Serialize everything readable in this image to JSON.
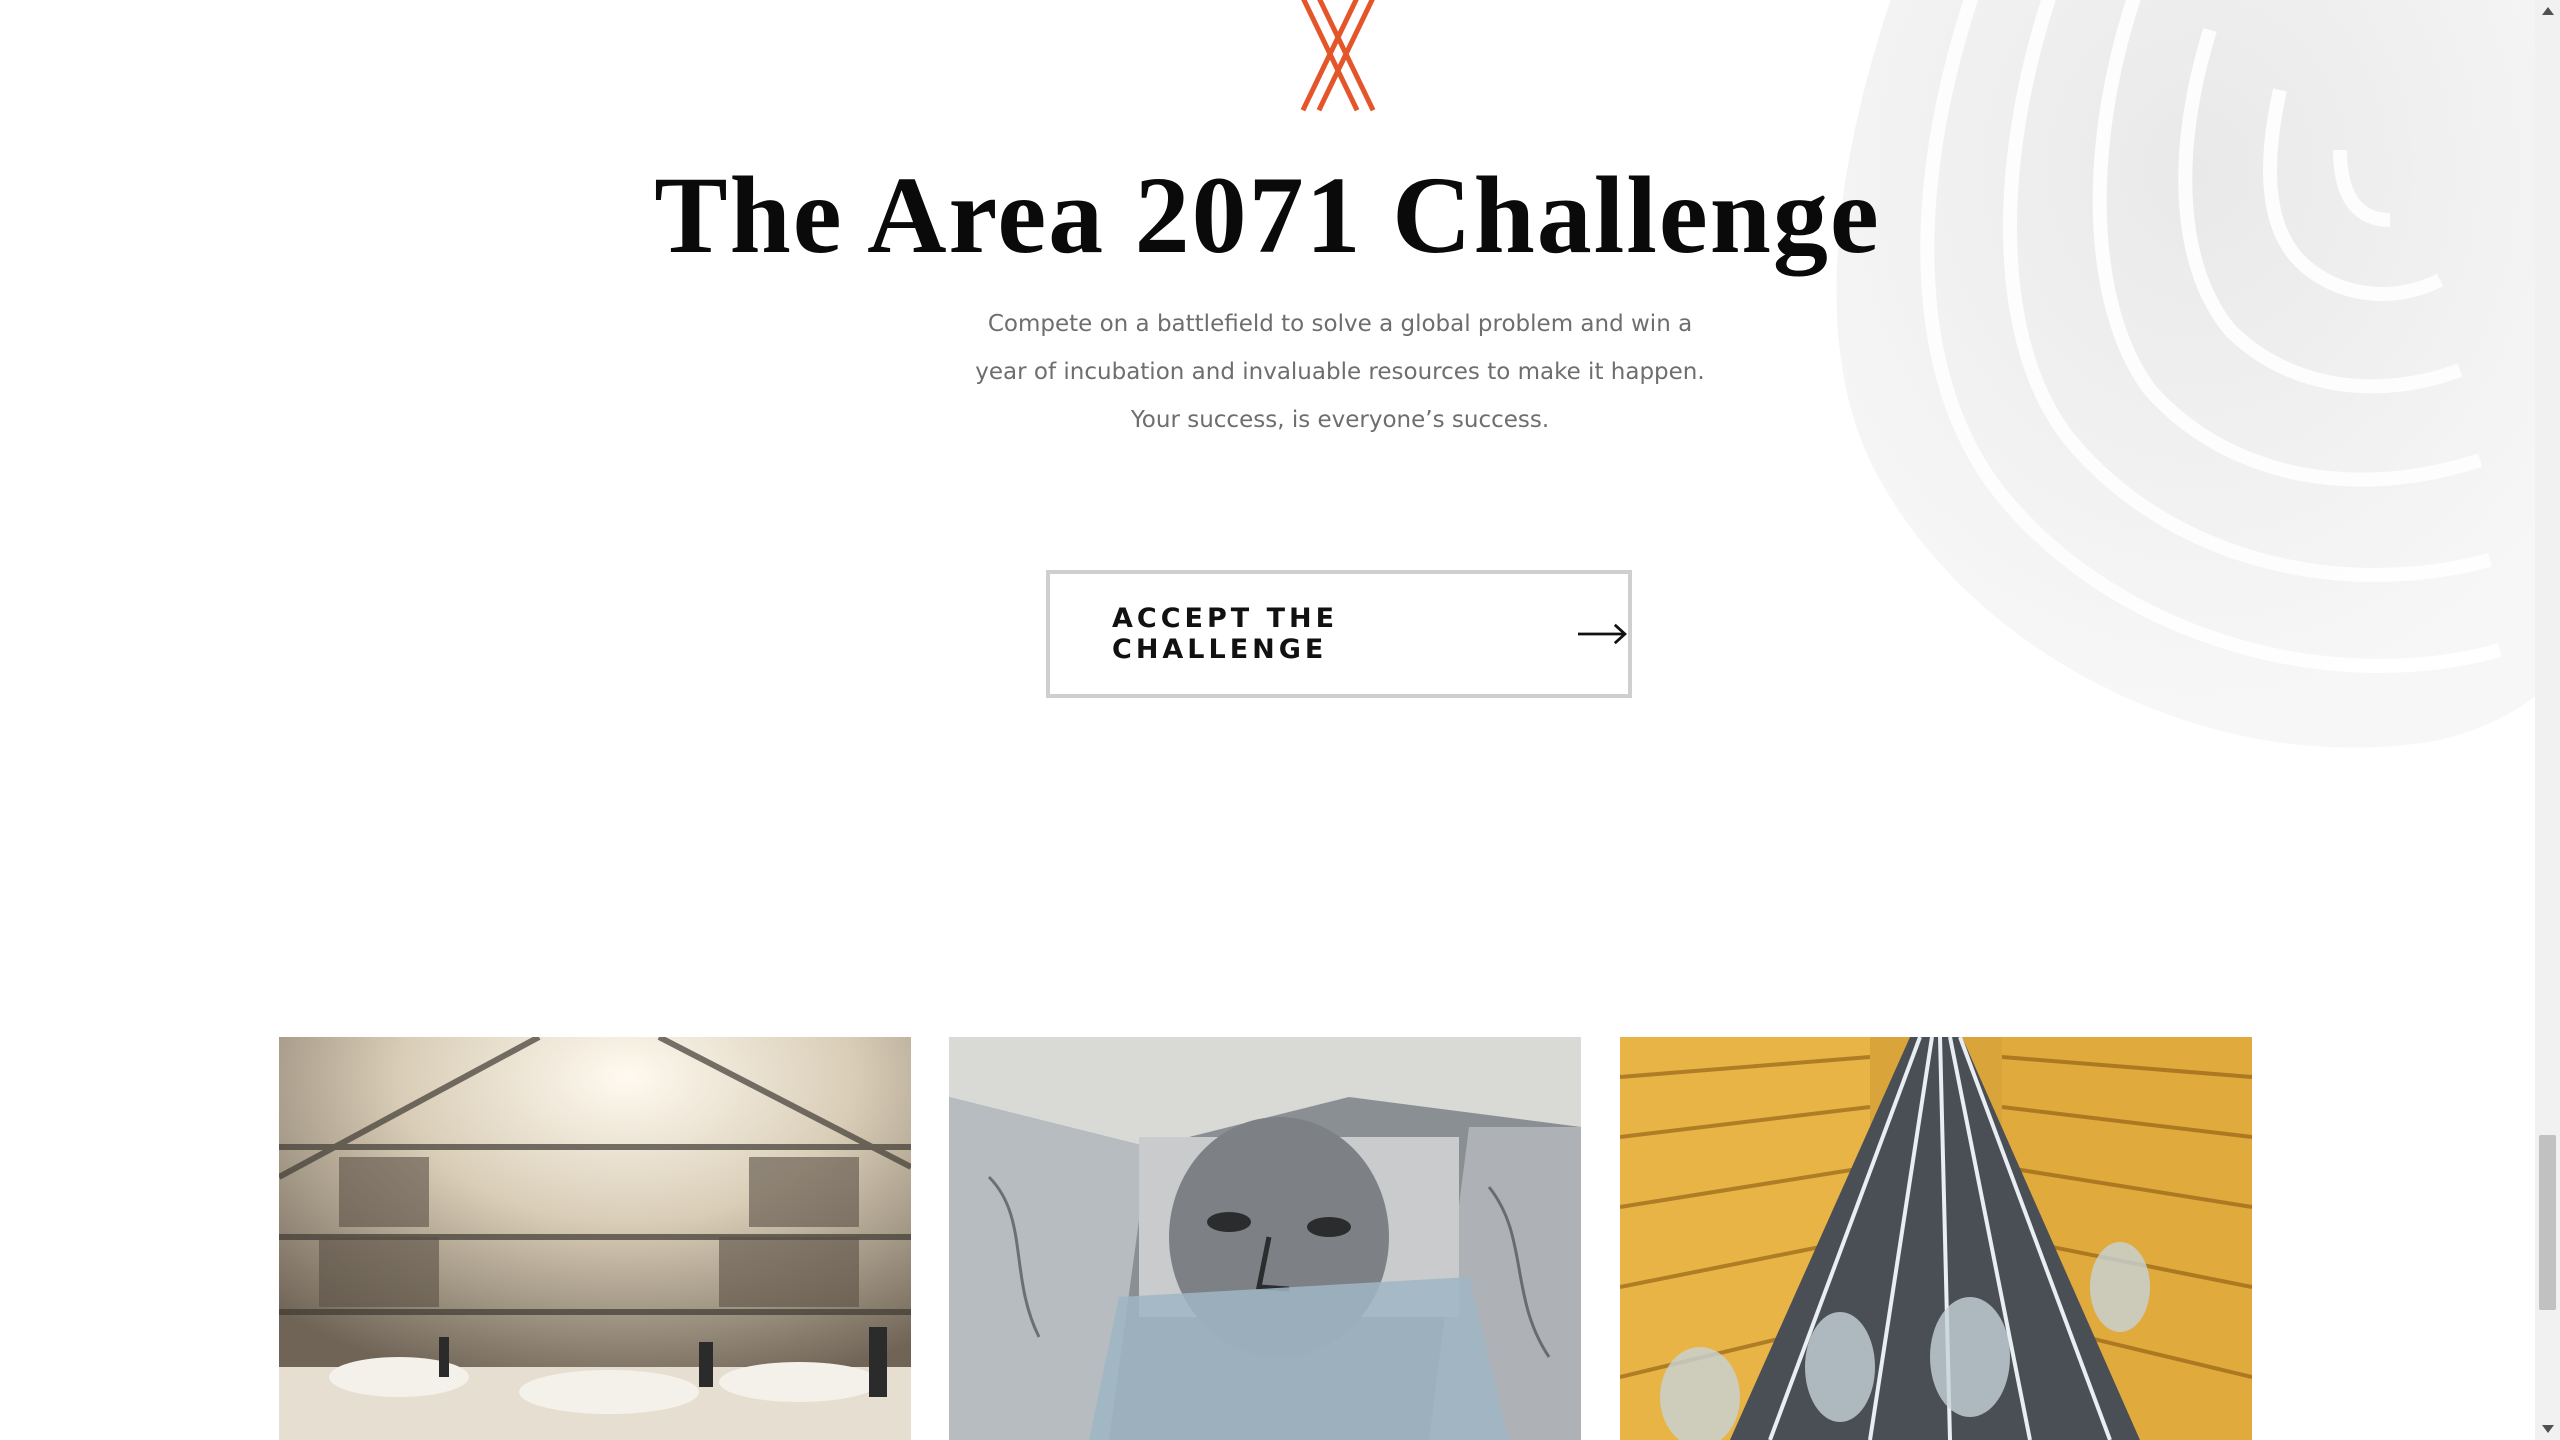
{
  "hero": {
    "title": "The Area 2071 Challenge",
    "description": "Compete on a battlefield to solve a global problem and win a year of incubation and invaluable resources to make it happen. Your success, is everyone’s success.",
    "cta_label": "ACCEPT THE CHALLENGE"
  },
  "colors": {
    "accent": "#e4562a",
    "title": "#0a0a0a",
    "body_text": "#6e6e6e",
    "button_border": "#cfcfcf"
  },
  "icons": {
    "logo": "area-2071-logo-mark",
    "cta": "arrow-right-icon",
    "scroll_up": "triangle-up-icon",
    "scroll_down": "triangle-down-icon"
  },
  "cards": [
    {
      "image": "atrium-interior-photo"
    },
    {
      "image": "banknote-portrait-photo"
    },
    {
      "image": "elevator-shaft-photo"
    }
  ]
}
